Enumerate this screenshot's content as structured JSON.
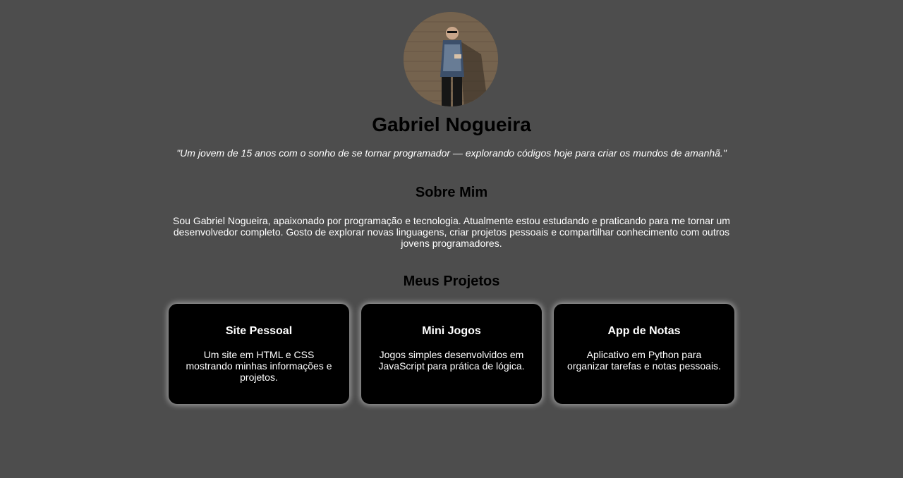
{
  "profile": {
    "name": "Gabriel Nogueira",
    "quote": "\"Um jovem de 15 anos com o sonho de se tornar programador — explorando códigos hoje para criar os mundos de amanhã.\""
  },
  "about": {
    "title": "Sobre Mim",
    "text": "Sou Gabriel Nogueira, apaixonado por programação e tecnologia. Atualmente estou estudando e praticando para me tornar um desenvolvedor completo. Gosto de explorar novas linguagens, criar projetos pessoais e compartilhar conhecimento com outros jovens programadores."
  },
  "projects": {
    "title": "Meus Projetos",
    "items": [
      {
        "title": "Site Pessoal",
        "description": "Um site em HTML e CSS mostrando minhas informações e projetos."
      },
      {
        "title": "Mini Jogos",
        "description": "Jogos simples desenvolvidos em JavaScript para prática de lógica."
      },
      {
        "title": "App de Notas",
        "description": "Aplicativo em Python para organizar tarefas e notas pessoais."
      }
    ]
  },
  "colors": {
    "background": "#4d4d4d",
    "card_background": "#000000",
    "text_light": "#ffffff",
    "text_dark": "#000000"
  }
}
